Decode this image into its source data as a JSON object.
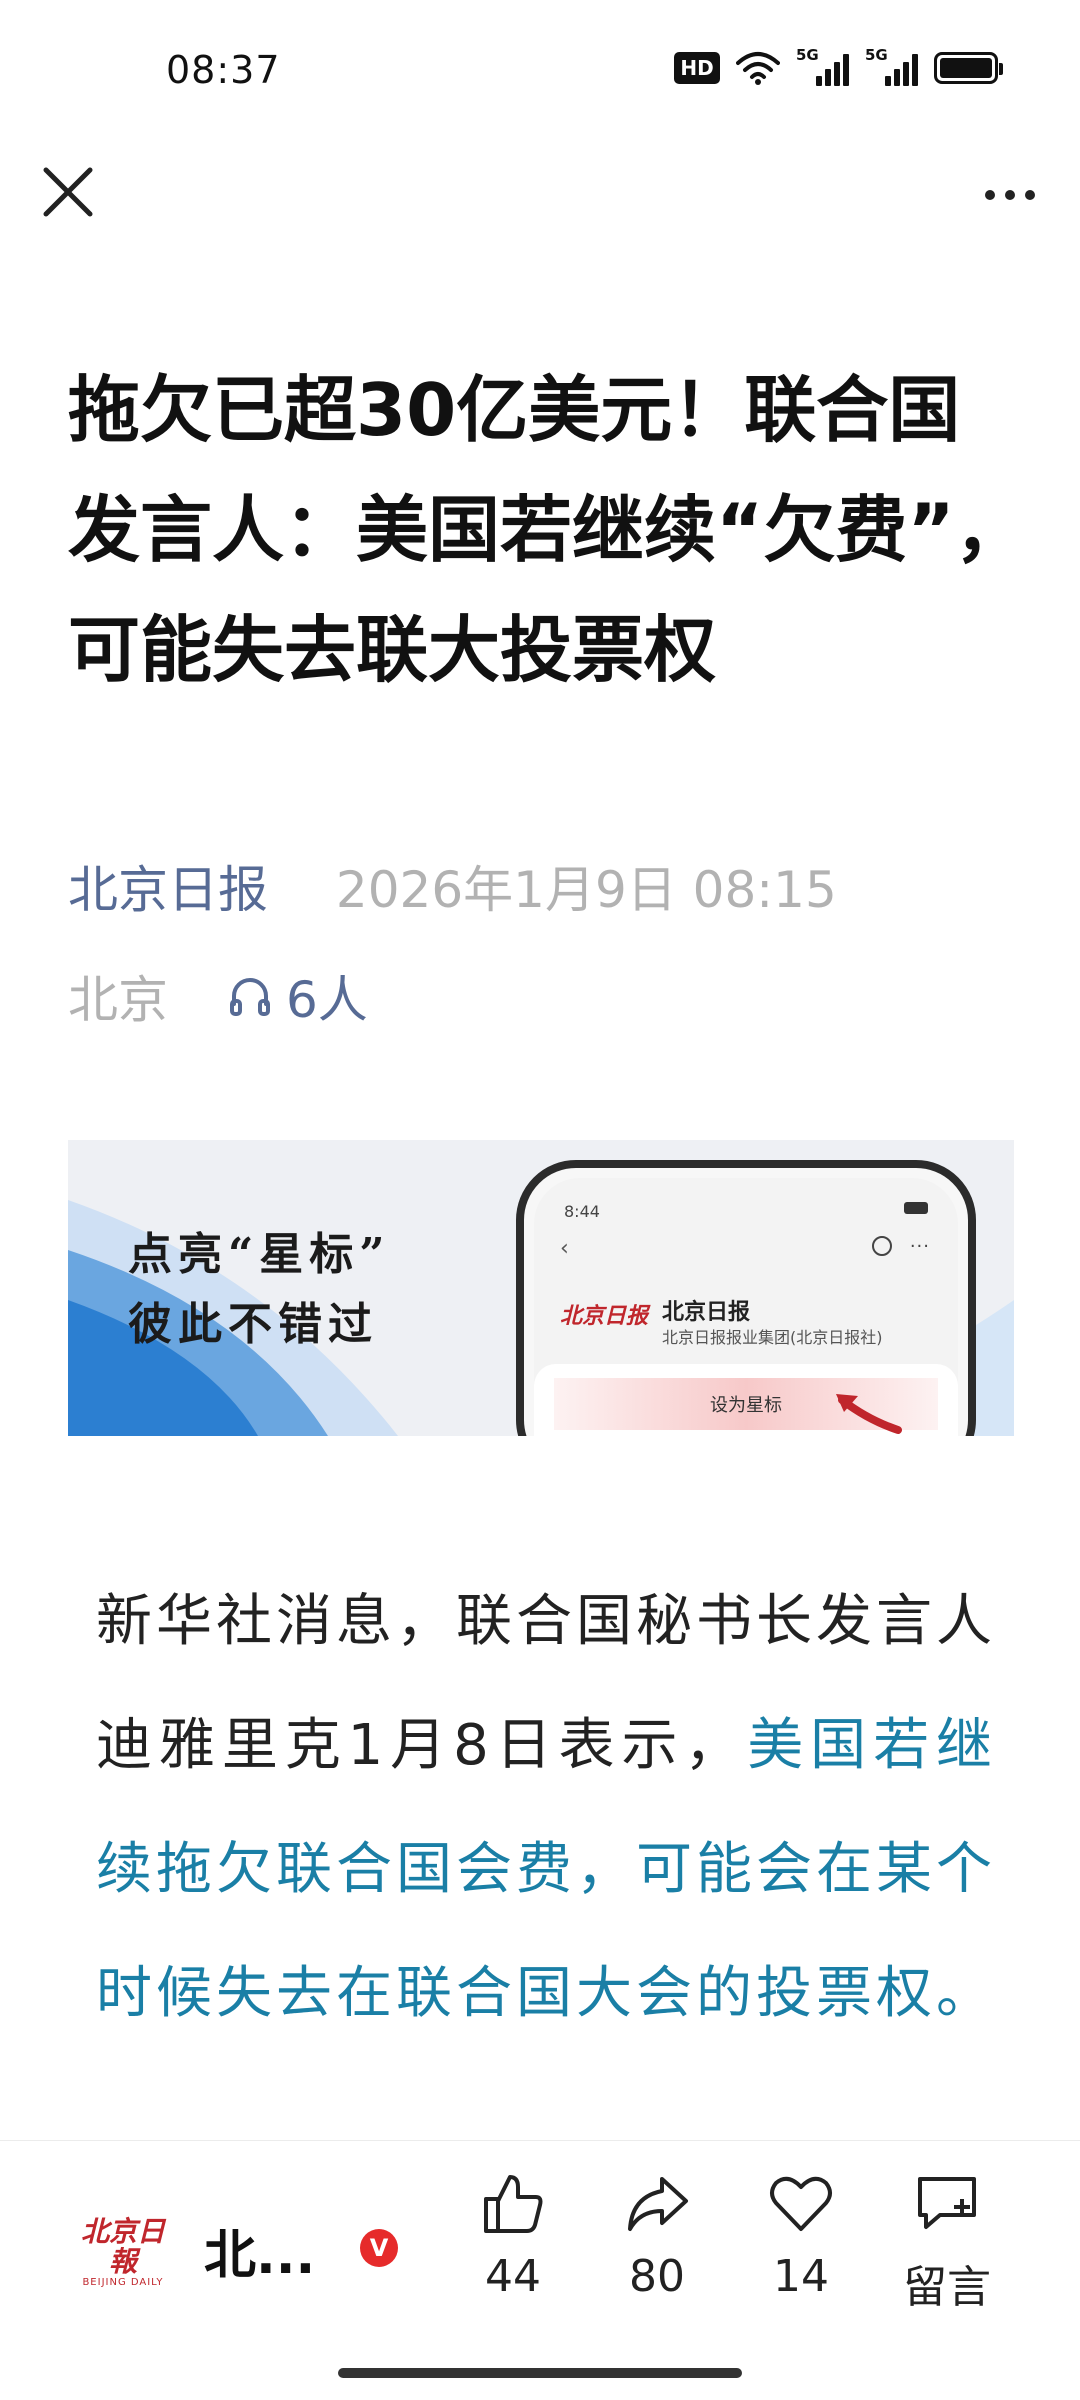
{
  "status_bar": {
    "time": "08:37",
    "hd_badge": "HD",
    "network_1": "5G",
    "network_2": "5G"
  },
  "nav": {
    "close_icon": "close-icon",
    "more_icon": "more-icon"
  },
  "article": {
    "title": "拖欠已超30亿美元！联合国发言人：美国若继续“欠费”，可能失去联大投票权",
    "source": "北京日报",
    "date": "2026年1月9日 08:15",
    "location": "北京",
    "listeners": "6人",
    "paragraph_plain": "新华社消息，联合国秘书长发言人迪雅里克1月8日表示，",
    "paragraph_highlight": "美国若继续拖欠联合国会费，可能会在某个时候失去在联合国大会的投票权。"
  },
  "banner": {
    "slogan_line1": "点亮“星标”",
    "slogan_line2": "彼此不错过",
    "phone_name": "北京日报",
    "phone_org": "北京日报报业集团(北京日报社)",
    "phone_button": "设为星标",
    "phone_logo": "北京日报"
  },
  "bottom_bar": {
    "account_logo_cn": "北京日報",
    "account_logo_en": "BEIJING DAILY",
    "account_name": "北...",
    "verified_badge": "V",
    "like_count": "44",
    "share_count": "80",
    "favorite_count": "14",
    "comment_label": "留言"
  },
  "colors": {
    "link_blue": "#576b95",
    "highlight_teal": "#1a7fa6",
    "meta_gray": "#b2b2b2",
    "verified_red": "#e62b2b"
  }
}
